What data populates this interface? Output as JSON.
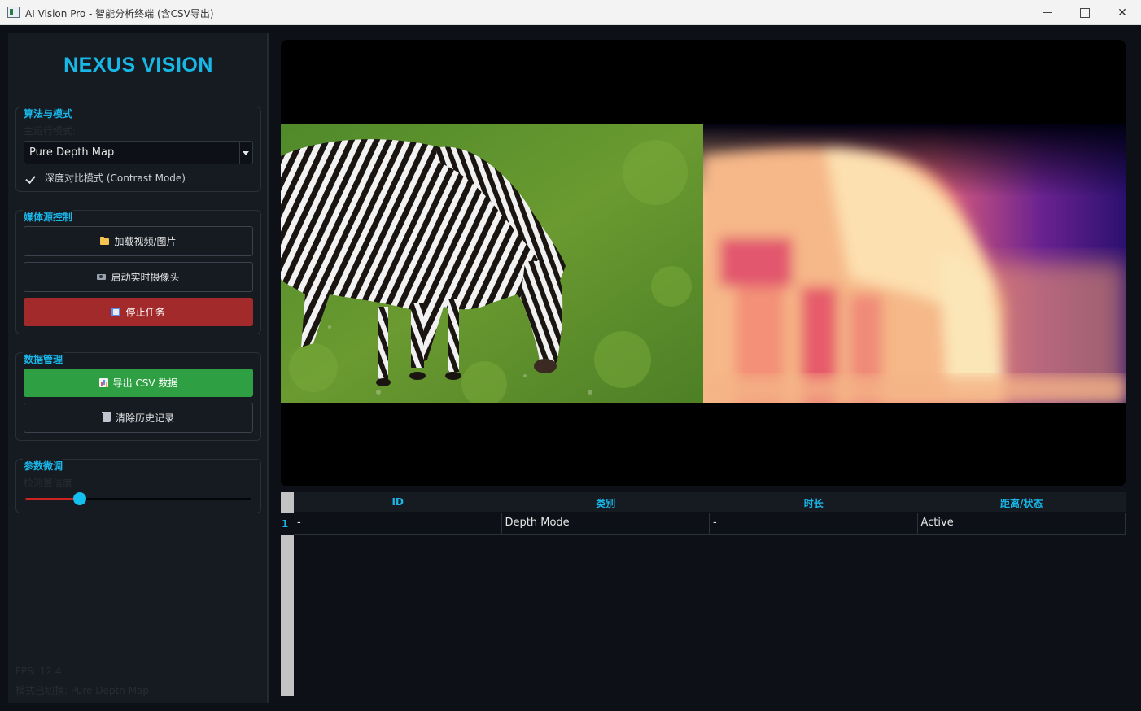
{
  "window": {
    "title": "AI Vision Pro - 智能分析终端 (含CSV导出)",
    "min_icon": "minimize-icon",
    "max_icon": "maximize-icon",
    "close_glyph": "✕"
  },
  "sidebar": {
    "logo": "NEXUS VISION",
    "algo_group": {
      "title": "算法与模式",
      "mode_label": "主运行模式:",
      "mode_value": "Pure Depth Map",
      "contrast_label": "深度对比模式 (Contrast Mode)",
      "contrast_checked": true
    },
    "media_group": {
      "title": "媒体源控制",
      "load_label": "加载视频/图片",
      "camera_label": "启动实时摄像头",
      "stop_label": "停止任务"
    },
    "data_group": {
      "title": "数据管理",
      "export_label": "导出 CSV 数据",
      "clear_label": "清除历史记录"
    },
    "param_group": {
      "title": "参数微调",
      "confidence_label": "检测置信度",
      "confidence_value": 0.24
    },
    "status": {
      "fps": "FPS: 12.4",
      "mode_switched": "模式已切换: Pure Depth Map"
    }
  },
  "table": {
    "headers": [
      "ID",
      "类别",
      "时长",
      "距离/状态"
    ],
    "rows": [
      {
        "num": "1",
        "cells": [
          "-",
          "Depth Mode",
          "-",
          "Active"
        ]
      }
    ]
  },
  "colors": {
    "accent": "#19b6e8",
    "stop": "#a32a2a",
    "export": "#2ea043",
    "background": "#0d1117",
    "panel": "#161b22"
  }
}
